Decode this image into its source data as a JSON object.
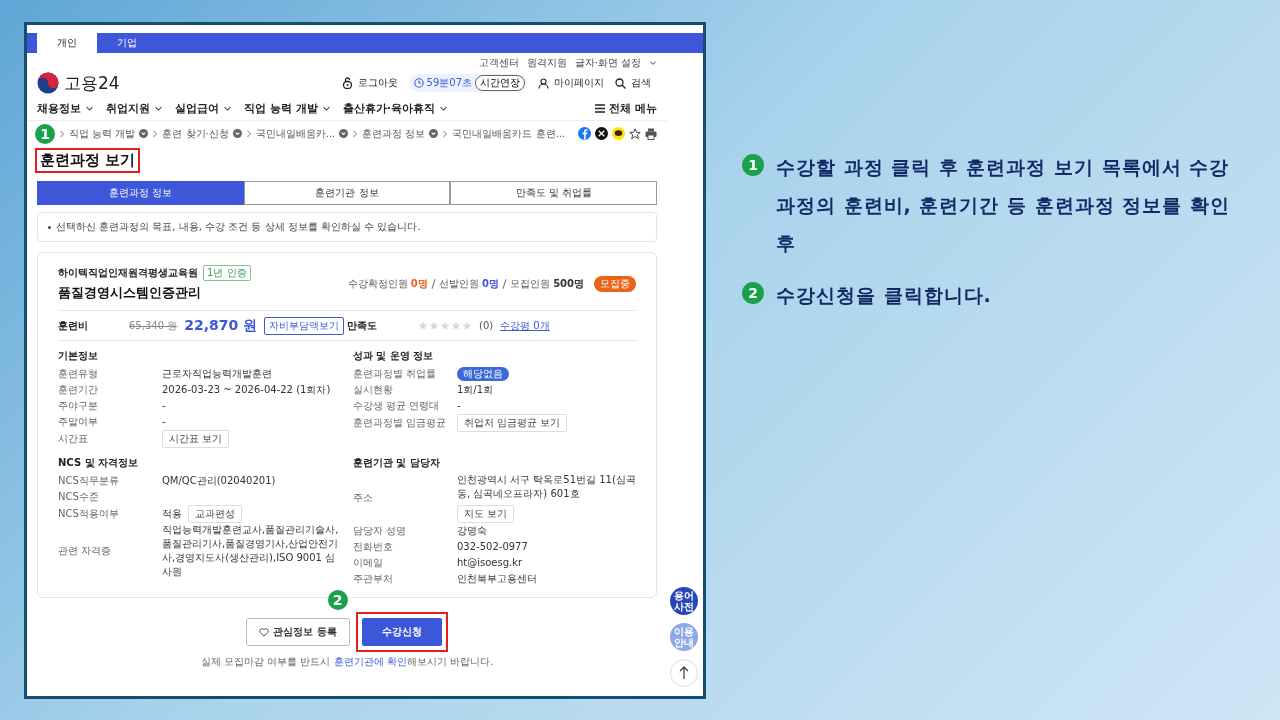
{
  "steps": [
    {
      "number": "1",
      "text": "수강할 과정 클릭 후 훈련과정 보기 목록에서 수강과정의 훈련비, 훈련기간 등 훈련과정 정보를 확인 후"
    },
    {
      "number": "2",
      "text": "수강신청을 클릭합니다."
    }
  ],
  "site": {
    "top_tabs": [
      {
        "label": "개인",
        "selected": true
      },
      {
        "label": "기업",
        "selected": false
      }
    ],
    "util_links": [
      "고객센터",
      "원격지원",
      "글자·화면 설정"
    ],
    "logo": "고용24",
    "logout": "로그아웃",
    "timer": "59분07초",
    "extend": "시간연장",
    "mypage": "마이페이지",
    "search": "검색",
    "nav": [
      "채용정보",
      "취업지원",
      "실업급여",
      "직업 능력 개발",
      "출산휴가·육아휴직"
    ],
    "all_menu": "전체 메뉴"
  },
  "breadcrumb": {
    "marker": "1",
    "items": [
      "직업 능력 개발",
      "훈련 찾기·신청",
      "국민내일배움카...",
      "훈련과정 정보",
      "국민내일배움카드 훈련..."
    ]
  },
  "title": "훈련과정 보기",
  "tabs": [
    {
      "label": "훈련과정 정보",
      "selected": true
    },
    {
      "label": "훈련기관 정보",
      "selected": false
    },
    {
      "label": "만족도 및 취업률",
      "selected": false
    }
  ],
  "notice": "선택하신 훈련과정의 목표, 내용, 수강 조건 등 상세 정보를 확인하실 수 있습니다.",
  "course": {
    "institution": "하이텍직업인재원격평생교육원",
    "cert_badge": "1년 인증",
    "name": "품질경영시스템인증관리",
    "counts": [
      {
        "label": "수강확정인원",
        "value": "0명",
        "kind": "confirmed"
      },
      {
        "label": "선발인원",
        "value": "0명",
        "kind": "selected"
      },
      {
        "label": "모집인원",
        "value": "500명",
        "kind": "total"
      }
    ],
    "status": "모집중",
    "fee_label": "훈련비",
    "original_fee": "65,340 원",
    "fee": "22,870 원",
    "fee_button": "자비부담액보기",
    "rating_label": "만족도",
    "stars": 0,
    "rating_count": "(0)",
    "review_link": "수강평 0개",
    "sections": [
      {
        "title": "기본정보",
        "rows": [
          {
            "label": "훈련유형",
            "value": "근로자직업능력개발훈련"
          },
          {
            "label": "훈련기간",
            "value": "2026-03-23 ~ 2026-04-22 (1회차)"
          },
          {
            "label": "주야구분",
            "value": "-"
          },
          {
            "label": "주말여부",
            "value": "-"
          },
          {
            "label": "시간표",
            "button": "시간표 보기"
          }
        ]
      },
      {
        "title": "성과 및 운영 정보",
        "rows": [
          {
            "label": "훈련과정별 취업률",
            "badge": "해당없음"
          },
          {
            "label": "실시현황",
            "value": "1회/1회"
          },
          {
            "label": "수강생 평균 연령대",
            "value": "-"
          },
          {
            "label": "훈련과정별 임금평균",
            "button": "취업처 임금평균 보기"
          }
        ]
      },
      {
        "title": "NCS 및 자격정보",
        "rows": [
          {
            "label": "NCS직무분류",
            "value": "QM/QC관리(02040201)"
          },
          {
            "label": "NCS수준"
          },
          {
            "label": "NCS적용여부",
            "value": "적용",
            "button": "교과편성"
          },
          {
            "label": "관련 자격증",
            "value": "직업능력개발훈련교사,품질관리기술사,품질관리기사,품질경영기사,산업안전기사,경영지도사(생산관리),ISO 9001 심사원"
          }
        ]
      },
      {
        "title": "훈련기관 및 담당자",
        "rows": [
          {
            "label": "주소",
            "value": "인천광역시 서구 탁옥로51번길 11(심곡동, 심곡네오프라자) 601호",
            "button": "지도 보기"
          },
          {
            "label": "담당자 성명",
            "value": "강명숙"
          },
          {
            "label": "전화번호",
            "value": "032-502-0977"
          },
          {
            "label": "이메일",
            "value": "ht@isoesg.kr"
          },
          {
            "label": "주관부처",
            "value": "인천북부고용센터"
          }
        ]
      }
    ]
  },
  "actions": {
    "interest": "관심정보 등록",
    "apply": "수강신청",
    "marker": "2"
  },
  "footnote": {
    "before": "실제 모집마감 여부를 반드시 ",
    "link": "훈련기관에 확인",
    "after": "해보시기 바랍니다."
  },
  "floating": [
    "용어 사전",
    "이용 안내"
  ]
}
